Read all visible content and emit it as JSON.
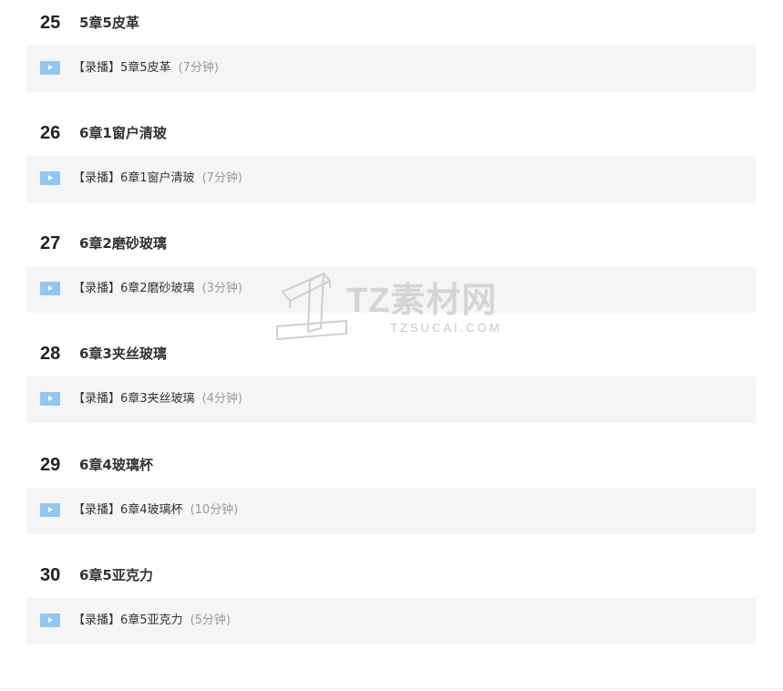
{
  "chapters": [
    {
      "number": "25",
      "title": "5章5皮革",
      "lesson": {
        "tag": "【录播】",
        "title": "5章5皮革",
        "duration": "(7分钟)"
      }
    },
    {
      "number": "26",
      "title": "6章1窗户清玻",
      "lesson": {
        "tag": "【录播】",
        "title": "6章1窗户清玻",
        "duration": "(7分钟)"
      }
    },
    {
      "number": "27",
      "title": "6章2磨砂玻璃",
      "lesson": {
        "tag": "【录播】",
        "title": "6章2磨砂玻璃",
        "duration": "(3分钟)"
      }
    },
    {
      "number": "28",
      "title": "6章3夹丝玻璃",
      "lesson": {
        "tag": "【录播】",
        "title": "6章3夹丝玻璃",
        "duration": "(4分钟)"
      }
    },
    {
      "number": "29",
      "title": "6章4玻璃杯",
      "lesson": {
        "tag": "【录播】",
        "title": "6章4玻璃杯",
        "duration": "(10分钟)"
      }
    },
    {
      "number": "30",
      "title": "6章5亚克力",
      "lesson": {
        "tag": "【录播】",
        "title": "6章5亚克力",
        "duration": "(5分钟)"
      }
    }
  ],
  "watermark": {
    "brand": "TZ素材网",
    "url": "TZSUCAI.COM"
  },
  "colors": {
    "lesson_bg": "#f5f5f5",
    "play_icon": "#8fc7f2",
    "duration_text": "#999999"
  }
}
